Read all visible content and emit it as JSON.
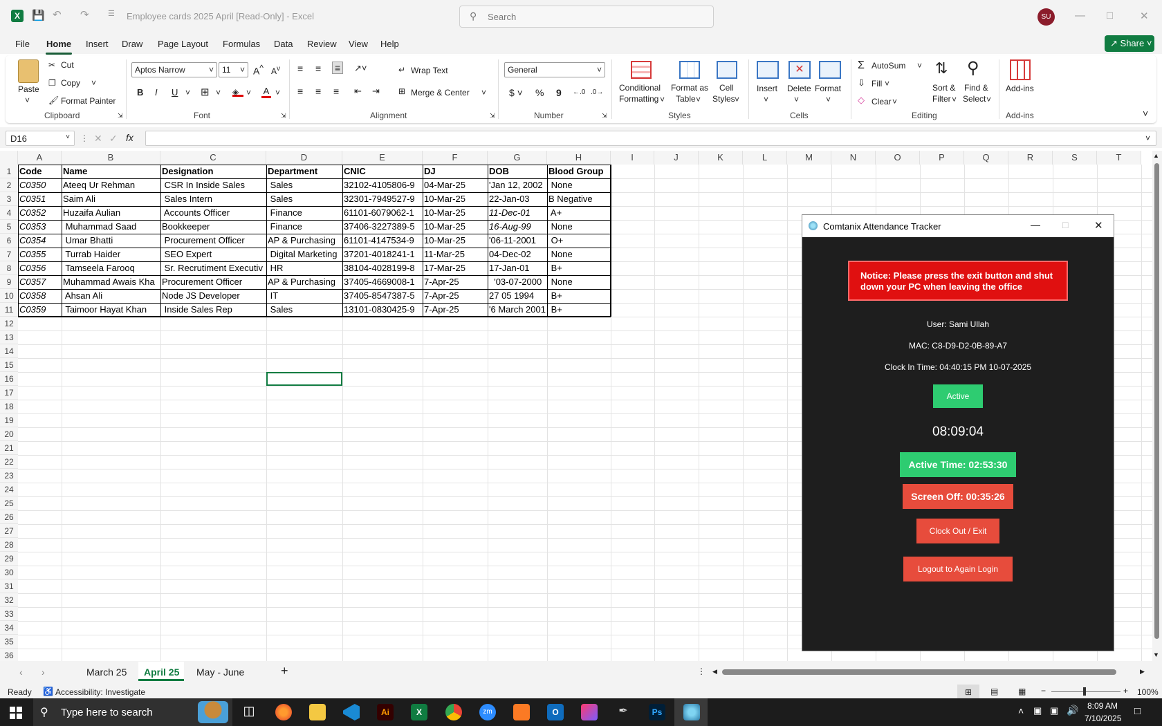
{
  "window": {
    "title": "Employee cards 2025 April  [Read-Only]  -  Excel",
    "search_placeholder": "Search",
    "user_initials": "SU"
  },
  "menu": [
    "File",
    "Home",
    "Insert",
    "Draw",
    "Page Layout",
    "Formulas",
    "Data",
    "Review",
    "View",
    "Help"
  ],
  "share_label": "Share",
  "ribbon": {
    "clipboard": {
      "paste": "Paste",
      "cut": "Cut",
      "copy": "Copy",
      "format_painter": "Format Painter",
      "group": "Clipboard"
    },
    "font": {
      "name": "Aptos Narrow",
      "size": "11",
      "group": "Font"
    },
    "alignment": {
      "wrap": "Wrap Text",
      "merge": "Merge & Center",
      "group": "Alignment"
    },
    "number": {
      "format": "General",
      "group": "Number"
    },
    "styles": {
      "cond1": "Conditional",
      "cond2": "Formatting",
      "table1": "Format as",
      "table2": "Table",
      "cell1": "Cell",
      "cell2": "Styles",
      "group": "Styles"
    },
    "cells": {
      "insert": "Insert",
      "delete": "Delete",
      "format": "Format",
      "group": "Cells"
    },
    "editing": {
      "autosum": "AutoSum",
      "fill": "Fill",
      "clear": "Clear",
      "sort1": "Sort &",
      "sort2": "Filter",
      "find1": "Find &",
      "find2": "Select",
      "group": "Editing"
    },
    "addins": {
      "label": "Add-ins",
      "group": "Add-ins"
    }
  },
  "name_box": "D16",
  "columns": [
    "A",
    "B",
    "C",
    "D",
    "E",
    "F",
    "G",
    "H",
    "I",
    "J",
    "K",
    "L",
    "M",
    "N",
    "O",
    "P",
    "Q",
    "R",
    "S",
    "T"
  ],
  "rows": [
    "1",
    "2",
    "3",
    "4",
    "5",
    "6",
    "7",
    "8",
    "9",
    "10",
    "11",
    "12",
    "13",
    "14",
    "15",
    "16",
    "17",
    "18",
    "19",
    "20",
    "21",
    "22",
    "23",
    "24",
    "25",
    "26",
    "27",
    "28",
    "29",
    "30",
    "31",
    "32",
    "33",
    "34",
    "35",
    "36"
  ],
  "table": {
    "headers": [
      "Code",
      "Name",
      "Designation",
      "Department",
      "CNIC",
      "DJ",
      "DOB",
      "Blood Group"
    ],
    "rows": [
      [
        "C0350",
        "Ateeq Ur Rehman",
        " CSR In Inside Sales",
        " Sales",
        "32102-4105806-9",
        "04-Mar-25",
        "'Jan 12, 2002",
        " None"
      ],
      [
        "C0351",
        "Saim Ali",
        " Sales Intern",
        " Sales",
        "32301-7949527-9",
        "10-Mar-25",
        "22-Jan-03",
        "B Negative"
      ],
      [
        "C0352",
        "Huzaifa Aulian",
        " Accounts Officer",
        " Finance",
        "61101-6079062-1",
        "10-Mar-25",
        "11-Dec-01",
        " A+"
      ],
      [
        "C0353",
        " Muhammad Saad",
        "Bookkeeper",
        " Finance",
        "37406-3227389-5",
        "10-Mar-25",
        "16-Aug-99",
        " None"
      ],
      [
        "C0354",
        " Umar Bhatti",
        " Procurement Officer",
        "AP & Purchasing",
        "61101-4147534-9",
        "10-Mar-25",
        "'06-11-2001",
        " O+"
      ],
      [
        "C0355",
        " Turrab Haider",
        " SEO Expert",
        " Digital Marketing",
        "37201-4018241-1",
        "11-Mar-25",
        "04-Dec-02",
        " None"
      ],
      [
        "C0356",
        " Tamseela Farooq",
        " Sr. Recrutiment Executiv",
        " HR",
        "38104-4028199-8",
        "17-Mar-25",
        "17-Jan-01",
        " B+"
      ],
      [
        "C0357",
        "Muhammad Awais Kha",
        "Procurement Officer",
        "AP & Purchasing",
        "37405-4669008-1",
        "7-Apr-25",
        "  '03-07-2000",
        " None"
      ],
      [
        "C0358",
        " Ahsan Ali",
        "Node JS Developer",
        " IT",
        "37405-8547387-5",
        "7-Apr-25",
        "27 05 1994",
        " B+"
      ],
      [
        "C0359",
        " Taimoor Hayat Khan",
        " Inside Sales Rep",
        " Sales",
        "13101-0830425-9",
        "7-Apr-25",
        "'6 March 2001",
        " B+"
      ]
    ]
  },
  "sheets": [
    "March 25",
    "April 25",
    "May - June"
  ],
  "status": {
    "ready": "Ready",
    "accessibility": "Accessibility: Investigate",
    "zoom": "100%"
  },
  "taskbar": {
    "search": "Type here to search",
    "time": "8:09 AM",
    "date": "7/10/2025"
  },
  "dialog": {
    "title": "Comtanix Attendance Tracker",
    "notice": "Notice: Please press the exit button and shut down your PC when leaving the office",
    "user": "User: Sami Ullah",
    "mac": "MAC: C8-D9-D2-0B-89-A7",
    "clock_in": "Clock In Time: 04:40:15 PM 10-07-2025",
    "status": "Active",
    "timer": "08:09:04",
    "active_time": "Active Time: 02:53:30",
    "screen_off": "Screen Off: 00:35:26",
    "clock_out": "Clock Out / Exit",
    "logout": "Logout to Again Login"
  },
  "colors": {
    "excel_green": "#107c41",
    "notice_red": "#e01010",
    "active_green": "#2ecc71",
    "danger_red": "#e74c3c",
    "dialog_bg": "#1e1e1e"
  }
}
